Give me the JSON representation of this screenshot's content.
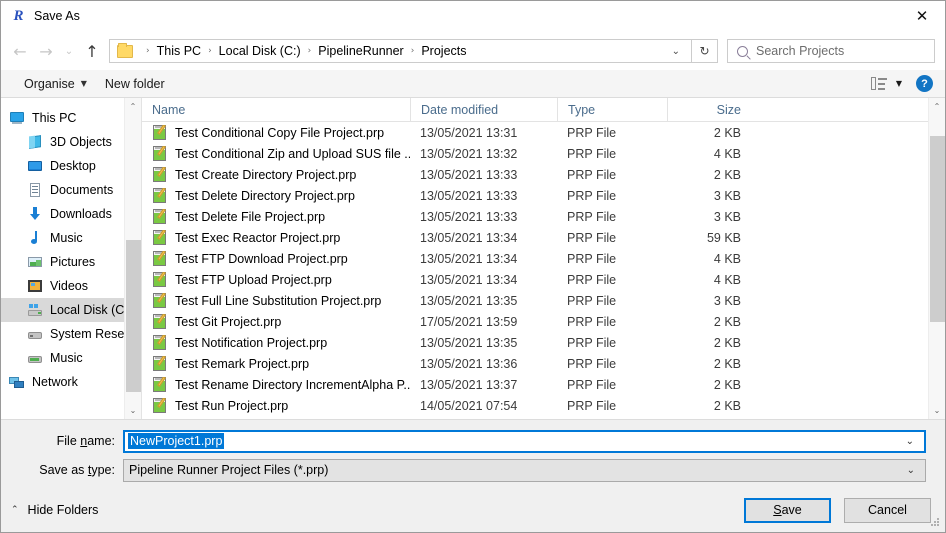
{
  "window": {
    "title": "Save As",
    "app_icon": "pipeline-runner-logo",
    "close_label": "✕"
  },
  "nav": {
    "back_icon": "←",
    "forward_icon": "→",
    "recent_icon": "⌄",
    "up_icon": "↑",
    "breadcrumb": [
      "This PC",
      "Local Disk (C:)",
      "PipelineRunner",
      "Projects"
    ],
    "breadcrumb_separator": "›",
    "breadcrumb_chevron": "⌄",
    "refresh_icon": "↻",
    "search_placeholder": "Search Projects"
  },
  "toolbar": {
    "organise_label": "Organise",
    "organise_caret": "▼",
    "new_folder_label": "New folder",
    "view_caret": "▼",
    "help_label": "?"
  },
  "sidebar": {
    "items": [
      {
        "label": "This PC",
        "icon": "this-pc-icon",
        "depth": 0,
        "selected": false
      },
      {
        "label": "3D Objects",
        "icon": "3d-objects-icon",
        "depth": 1,
        "selected": false
      },
      {
        "label": "Desktop",
        "icon": "desktop-icon",
        "depth": 1,
        "selected": false
      },
      {
        "label": "Documents",
        "icon": "documents-icon",
        "depth": 1,
        "selected": false
      },
      {
        "label": "Downloads",
        "icon": "downloads-icon",
        "depth": 1,
        "selected": false
      },
      {
        "label": "Music",
        "icon": "music-note-icon",
        "depth": 1,
        "selected": false
      },
      {
        "label": "Pictures",
        "icon": "pictures-icon",
        "depth": 1,
        "selected": false
      },
      {
        "label": "Videos",
        "icon": "videos-icon",
        "depth": 1,
        "selected": false
      },
      {
        "label": "Local Disk (C:)",
        "icon": "local-disk-icon",
        "depth": 1,
        "selected": true
      },
      {
        "label": "System Reserved",
        "icon": "drive-icon",
        "depth": 1,
        "selected": false
      },
      {
        "label": "Music",
        "icon": "network-drive-icon",
        "depth": 1,
        "selected": false
      },
      {
        "label": "Network",
        "icon": "network-icon",
        "depth": 0,
        "selected": false
      }
    ],
    "scroll_up_icon": "⌃",
    "scroll_down_icon": "⌄"
  },
  "filelist": {
    "columns": [
      "Name",
      "Date modified",
      "Type",
      "Size"
    ],
    "sort_caret": "⌃",
    "scroll_up_icon": "⌃",
    "scroll_down_icon": "⌄",
    "rows": [
      {
        "name": "Test Conditional Copy File Project.prp",
        "date": "13/05/2021 13:31",
        "type": "PRP File",
        "size": "2 KB"
      },
      {
        "name": "Test Conditional Zip and Upload SUS file ...",
        "date": "13/05/2021 13:32",
        "type": "PRP File",
        "size": "4 KB"
      },
      {
        "name": "Test Create Directory Project.prp",
        "date": "13/05/2021 13:33",
        "type": "PRP File",
        "size": "2 KB"
      },
      {
        "name": "Test Delete Directory Project.prp",
        "date": "13/05/2021 13:33",
        "type": "PRP File",
        "size": "3 KB"
      },
      {
        "name": "Test Delete File Project.prp",
        "date": "13/05/2021 13:33",
        "type": "PRP File",
        "size": "3 KB"
      },
      {
        "name": "Test Exec Reactor Project.prp",
        "date": "13/05/2021 13:34",
        "type": "PRP File",
        "size": "59 KB"
      },
      {
        "name": "Test FTP Download Project.prp",
        "date": "13/05/2021 13:34",
        "type": "PRP File",
        "size": "4 KB"
      },
      {
        "name": "Test FTP Upload Project.prp",
        "date": "13/05/2021 13:34",
        "type": "PRP File",
        "size": "4 KB"
      },
      {
        "name": "Test Full Line Substitution Project.prp",
        "date": "13/05/2021 13:35",
        "type": "PRP File",
        "size": "3 KB"
      },
      {
        "name": "Test Git Project.prp",
        "date": "17/05/2021 13:59",
        "type": "PRP File",
        "size": "2 KB"
      },
      {
        "name": "Test Notification Project.prp",
        "date": "13/05/2021 13:35",
        "type": "PRP File",
        "size": "2 KB"
      },
      {
        "name": "Test Remark Project.prp",
        "date": "13/05/2021 13:36",
        "type": "PRP File",
        "size": "2 KB"
      },
      {
        "name": "Test Rename Directory IncrementAlpha P...",
        "date": "13/05/2021 13:37",
        "type": "PRP File",
        "size": "2 KB"
      },
      {
        "name": "Test Run Project.prp",
        "date": "14/05/2021 07:54",
        "type": "PRP File",
        "size": "2 KB"
      }
    ]
  },
  "form": {
    "filename_label_pre": "File ",
    "filename_label_accel": "n",
    "filename_label_post": "ame:",
    "filename_value": "NewProject1.prp",
    "filetype_label_pre": "Save as ",
    "filetype_label_accel": "t",
    "filetype_label_post": "ype:",
    "filetype_value": "Pipeline Runner Project Files (*.prp)",
    "combo_caret": "⌄"
  },
  "footer": {
    "hide_folders_caret": "⌃",
    "hide_folders_label": "Hide Folders",
    "save_label_pre": "",
    "save_label_accel": "S",
    "save_label_post": "ave",
    "cancel_label": "Cancel"
  },
  "colors": {
    "accent": "#0078d7",
    "selection": "#0078d7",
    "header_text": "#4a6c8c",
    "help_blue": "#1275c4"
  }
}
